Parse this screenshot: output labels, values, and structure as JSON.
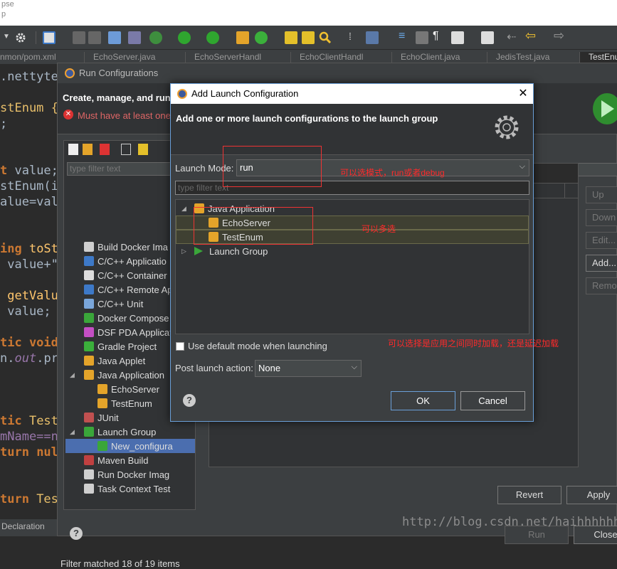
{
  "window": {
    "title_fragment_1": "pse",
    "title_fragment_2": "p"
  },
  "toolbar": {
    "icons": [
      "dropdown-icon",
      "gear-icon",
      "new-icon",
      "save-icon",
      "save-all-icon",
      "screen-icon",
      "skip-icon",
      "debug-icon",
      "run-icon",
      "run-config-icon",
      "new-package-icon",
      "new-class-icon",
      "open-type-icon",
      "open-task-icon",
      "search-icon",
      "breadcrumb-icon",
      "highlight-icon",
      "sync-icon",
      "block-icon",
      "pilcrow-icon",
      "outline-icon",
      "pin-icon",
      "back-icon",
      "arrow-left-icon",
      "arrow-right-icon"
    ]
  },
  "editor_tabs": [
    {
      "label": "nmon/pom.xml"
    },
    {
      "label": "EchoServer.java"
    },
    {
      "label": "EchoServerHandl"
    },
    {
      "label": "EchoClientHandl"
    },
    {
      "label": "EchoClient.java"
    },
    {
      "label": "JedisTest.java"
    },
    {
      "label": "TestEnu",
      "active": true
    }
  ],
  "code": {
    "line1": ".nettyte",
    "line2_id": "stEnum {",
    "line3": ";",
    "line4_kw": "t",
    "line4_id": " value;",
    "line5": "stEnum(i",
    "line6": "alue=val",
    "line7_kw": "ing",
    "line7_fn": " toSt",
    "line8": " value+\"",
    "line9_fn": " getValu",
    "line10": " value;",
    "line11_kw": "tic void",
    "line12_a": "n.",
    "line12_b": "out",
    "line12_c": ".pri",
    "line13_kw": "tic",
    "line13_ty": " Test",
    "line14": "mName==n",
    "line15_kw": "turn",
    "line15_id": " nul",
    "line16_kw": "turn",
    "line16_ty": " Tes"
  },
  "bottom_bar": {
    "label": "Declaration"
  },
  "run_configurations": {
    "title": "Run Configurations",
    "header": "Create, manage, and run",
    "error": "Must have at least one",
    "filter_placeholder": "type filter text",
    "tree": [
      {
        "label": "Build Docker Ima",
        "icon_color": "#cfcfcf",
        "level": 1
      },
      {
        "label": "C/C++ Applicatio",
        "icon_color": "#3d79c8",
        "level": 1
      },
      {
        "label": "C/C++ Container",
        "icon_color": "#dddddd",
        "level": 1
      },
      {
        "label": "C/C++ Remote Ap",
        "icon_color": "#3d79c8",
        "level": 1
      },
      {
        "label": "C/C++ Unit",
        "icon_color": "#7aa6da",
        "level": 1
      },
      {
        "label": "Docker Compose",
        "icon_color": "#3aa63a",
        "level": 1
      },
      {
        "label": "DSF PDA Applicat",
        "icon_color": "#c44fc4",
        "level": 1
      },
      {
        "label": "Gradle Project",
        "icon_color": "#3bb03b",
        "level": 1
      },
      {
        "label": "Java Applet",
        "icon_color": "#e4a42a",
        "level": 1
      },
      {
        "label": "Java Application",
        "icon_color": "#e4a42a",
        "level": 1,
        "expanded": true
      },
      {
        "label": "EchoServer",
        "icon_color": "#e4a42a",
        "level": 2
      },
      {
        "label": "TestEnum",
        "icon_color": "#e4a42a",
        "level": 2
      },
      {
        "label": "JUnit",
        "icon_color": "#c05050",
        "level": 1
      },
      {
        "label": "Launch Group",
        "icon_color": "#3aa63a",
        "level": 1,
        "expanded": true
      },
      {
        "label": "New_configura",
        "icon_color": "#3aa63a",
        "level": 2,
        "selected": true
      },
      {
        "label": "Maven Build",
        "icon_color": "#c04040",
        "level": 1
      },
      {
        "label": "Run Docker Imag",
        "icon_color": "#cfcfcf",
        "level": 1
      },
      {
        "label": "Task Context Test",
        "icon_color": "#cfcfcf",
        "level": 1
      }
    ],
    "status": "Filter matched 18 of 19 items",
    "side_buttons": {
      "up": "Up",
      "down": "Down",
      "edit": "Edit...",
      "add": "Add...",
      "remove": "Remove"
    },
    "revert": "Revert",
    "apply": "Apply",
    "run": "Run",
    "close": "Close"
  },
  "add_launch": {
    "title": "Add Launch Configuration",
    "header": "Add one or more launch configurations to the launch group",
    "mode_label": "Launch Mode:",
    "mode_value": "run",
    "filter_placeholder": "type filter text",
    "tree": {
      "group": "Java Application",
      "items": [
        "EchoServer",
        "TestEnum"
      ],
      "launch_group": "Launch Group"
    },
    "checkbox_label": "Use default mode when launching",
    "post_label": "Post launch action:",
    "post_value": "None",
    "ok": "OK",
    "cancel": "Cancel",
    "help": "?"
  },
  "annotations": {
    "mode": "可以选模式，run或者debug",
    "multi": "可以多选",
    "load": "可以选择是应用之间同时加载，还是延迟加载"
  },
  "watermark": "http://blog.csdn.net/haihhhhhh"
}
